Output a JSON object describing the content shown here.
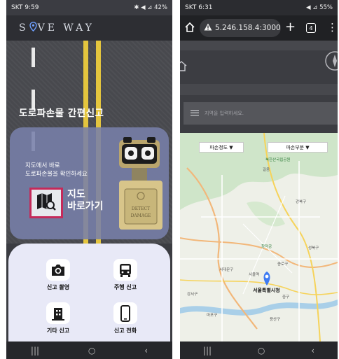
{
  "left_phone": {
    "status": {
      "time": "SKT 9:59",
      "right": "✱ ◀︎ ⊿ 42%"
    },
    "brand": {
      "part1": "S",
      "part2": "VE WAY"
    },
    "report_title": "도로파손물 간편신고",
    "card": {
      "desc_line1": "지도에서 바로",
      "desc_line2": "도로파손물을 확인하세요",
      "btn_line1": "지도",
      "btn_line2": "바로가기",
      "robot_text1": "DETECT",
      "robot_text2": "DAMAGE"
    },
    "menu": [
      {
        "label": "신고 촬영",
        "icon": "camera-icon"
      },
      {
        "label": "주행 신고",
        "icon": "bus-icon"
      },
      {
        "label": "기타 신고",
        "icon": "building-icon"
      },
      {
        "label": "신고 전화",
        "icon": "phone-icon"
      }
    ],
    "nav": {
      "recent": "|||",
      "home": "○",
      "back": "‹"
    }
  },
  "right_phone": {
    "status": {
      "time": "SKT 6:31",
      "right": "◀ ⊿ 55%"
    },
    "browser": {
      "url": "5.246.158.4:3000",
      "plus": "+",
      "tabs": "4",
      "menu": "⋮"
    },
    "search_placeholder": "지역을 입력하세요.",
    "dropdowns": {
      "left": "파손정도 ▼",
      "right": "파손부분 ▼"
    },
    "map_labels": {
      "forest": "북한산국립공원",
      "gil": "길음",
      "gangbuk": "강북구",
      "seongbuk": "성북구",
      "changdeok": "창덕궁",
      "jongno": "종로구",
      "seodaemun": "서대문구",
      "seoul_station": "서울역",
      "seoul_city_hall": "서울특별시청",
      "jung": "중구",
      "yongsan": "용산구",
      "gangseo": "강서구",
      "mapo": "마포구"
    },
    "nav": {
      "recent": "|||",
      "home": "○",
      "back": "‹"
    }
  }
}
